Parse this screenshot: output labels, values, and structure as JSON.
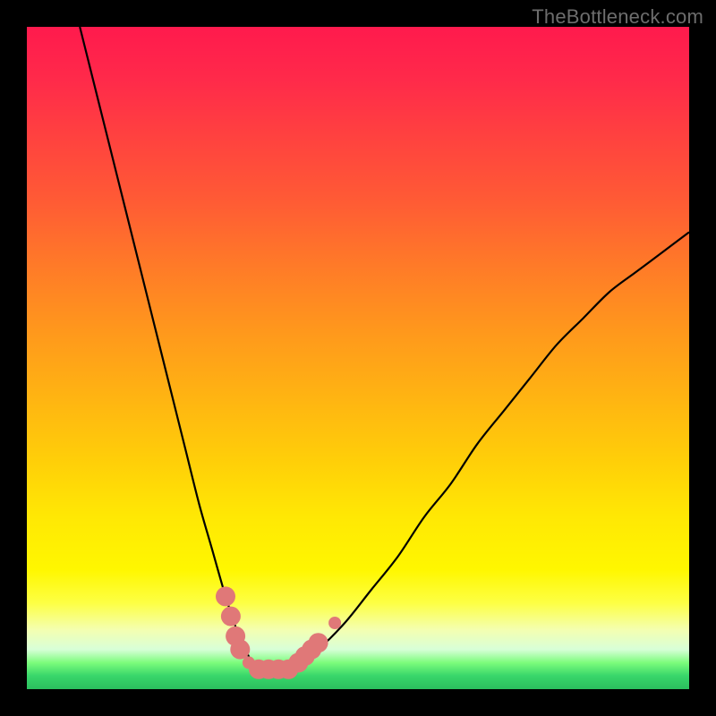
{
  "watermark": "TheBottleneck.com",
  "chart_data": {
    "type": "line",
    "title": "",
    "xlabel": "",
    "ylabel": "",
    "xlim": [
      0,
      100
    ],
    "ylim": [
      0,
      100
    ],
    "series": [
      {
        "name": "bottleneck-curve",
        "x": [
          8,
          10,
          12,
          14,
          16,
          18,
          20,
          22,
          24,
          26,
          28,
          30,
          31,
          32,
          33,
          34,
          35,
          36,
          38,
          40,
          41,
          44,
          48,
          52,
          56,
          60,
          64,
          68,
          72,
          76,
          80,
          84,
          88,
          92,
          96,
          100
        ],
        "values": [
          100,
          92,
          84,
          76,
          68,
          60,
          52,
          44,
          36,
          28,
          21,
          14,
          11,
          8,
          6,
          4,
          3,
          3,
          3,
          3,
          4,
          6,
          10,
          15,
          20,
          26,
          31,
          37,
          42,
          47,
          52,
          56,
          60,
          63,
          66,
          69
        ]
      }
    ],
    "markers": {
      "name": "highlight-points",
      "color": "#e07878",
      "large_radius": 11,
      "small_radius": 7,
      "points": [
        {
          "x": 30.0,
          "y": 14,
          "r": "large"
        },
        {
          "x": 30.8,
          "y": 11,
          "r": "large"
        },
        {
          "x": 31.5,
          "y": 8,
          "r": "large"
        },
        {
          "x": 32.2,
          "y": 6,
          "r": "large"
        },
        {
          "x": 33.5,
          "y": 4,
          "r": "small"
        },
        {
          "x": 35.0,
          "y": 3,
          "r": "large"
        },
        {
          "x": 36.5,
          "y": 3,
          "r": "large"
        },
        {
          "x": 38.0,
          "y": 3,
          "r": "large"
        },
        {
          "x": 39.5,
          "y": 3,
          "r": "large"
        },
        {
          "x": 41.0,
          "y": 4,
          "r": "large"
        },
        {
          "x": 42.0,
          "y": 5,
          "r": "large"
        },
        {
          "x": 43.0,
          "y": 6,
          "r": "large"
        },
        {
          "x": 44.0,
          "y": 7,
          "r": "large"
        },
        {
          "x": 46.5,
          "y": 10,
          "r": "small"
        }
      ]
    }
  }
}
